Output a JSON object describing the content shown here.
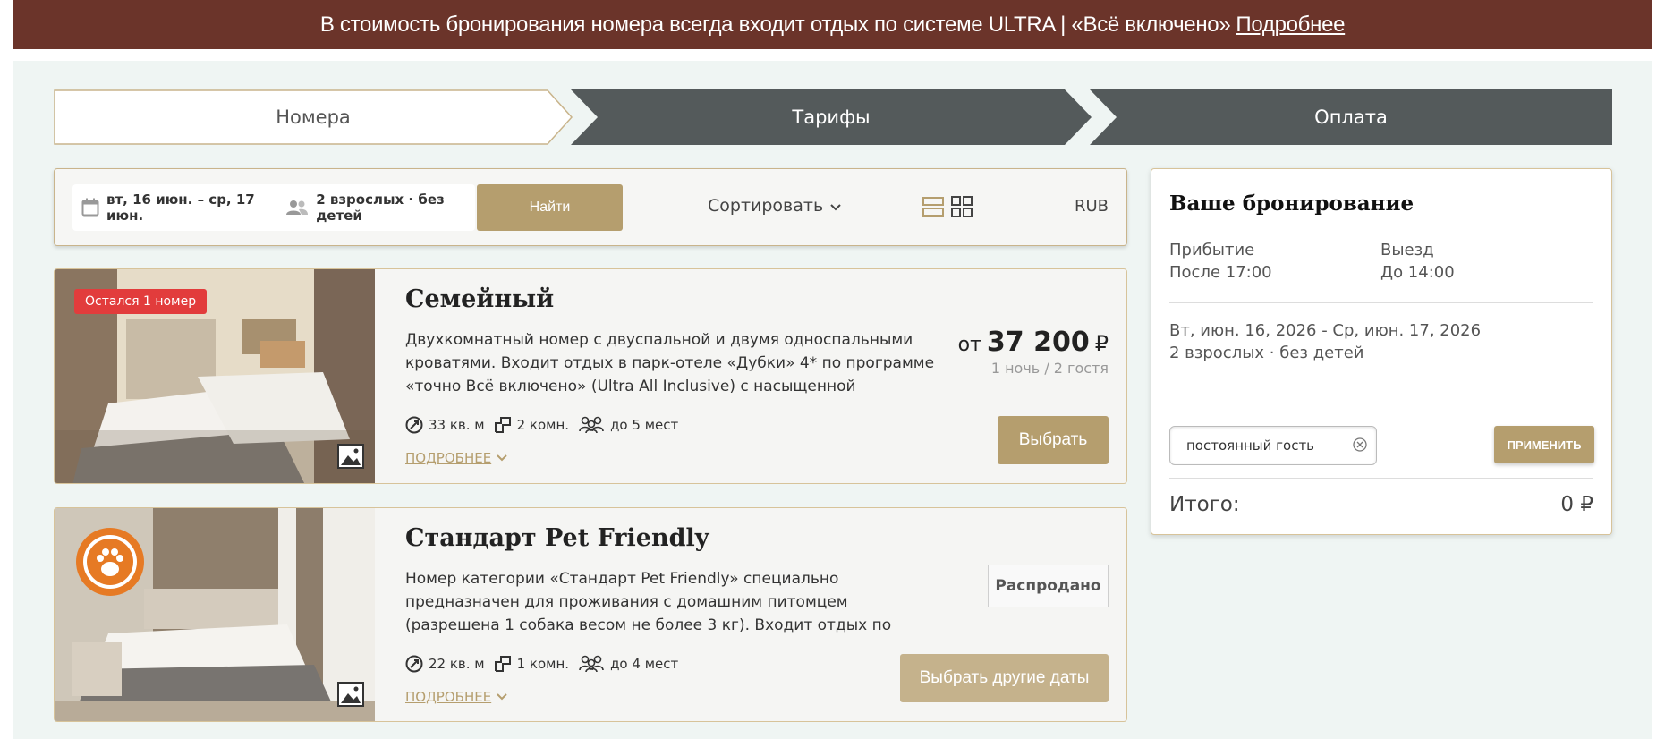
{
  "colors": {
    "brand_brown": "#6b342a",
    "gold": "#b59e6e",
    "step_dark": "#545a5b",
    "badge_red": "#e23c3c",
    "page_bg": "#eff5f3"
  },
  "banner": {
    "text": "В стоимость бронирования номера всегда входит отдых по системе ULTRA | «Всё включено»",
    "link": "Подробнее"
  },
  "steps": [
    {
      "label": "Номера",
      "active": true
    },
    {
      "label": "Тарифы",
      "active": false
    },
    {
      "label": "Оплата",
      "active": false
    }
  ],
  "search": {
    "dates": "вт, 16 июн. – ср, 17 июн.",
    "guests": "2 взрослых · без детей",
    "button": "Найти",
    "sort": "Сортировать",
    "currency": "RUB",
    "icons": [
      "calendar-icon",
      "guests-icon",
      "list-view-icon",
      "grid-view-icon",
      "chevron-down-icon"
    ]
  },
  "rooms": [
    {
      "badge": "Остался 1 номер",
      "title": "Семейный",
      "description": "Двухкомнатный номер с двуспальной и двумя односпальными кроватями. Входит отдых в парк-отеле «Дубки» 4* по программе «точно Всё включено» (Ultra All Inclusive) с насыщенной анимационной",
      "area": "33 кв. м",
      "rooms_count": "2 комн.",
      "capacity": "до 5 мест",
      "more": "ПОДРОБНЕЕ",
      "price_prefix": "от",
      "price": "37 200",
      "price_currency": "₽",
      "price_note": "1 ночь / 2 гостя",
      "button": "Выбрать"
    },
    {
      "badge_icon": "pet-friendly-paw-icon",
      "title": "Стандарт Pet Friendly",
      "description": "Номер категории «Стандарт Pet Friendly» специально предназначен для проживания с домашним питомцем (разрешена 1 собака весом не более 3 кг). Входит отдых по",
      "area": "22 кв. м",
      "rooms_count": "1 комн.",
      "capacity": "до 4 мест",
      "more": "ПОДРОБНЕЕ",
      "status": "Распродано",
      "button": "Выбрать другие даты"
    }
  ],
  "booking": {
    "title": "Ваше бронирование",
    "arrival_label": "Прибытие",
    "arrival_value": "После 17:00",
    "departure_label": "Выезд",
    "departure_value": "До 14:00",
    "dates": "Вт, июн. 16, 2026 - Ср, июн. 17, 2026",
    "guests": "2 взрослых · без детей",
    "promo_value": "постоянный гость",
    "apply": "ПРИМЕНИТЬ",
    "total_label": "Итого:",
    "total_value": "0 ₽"
  }
}
